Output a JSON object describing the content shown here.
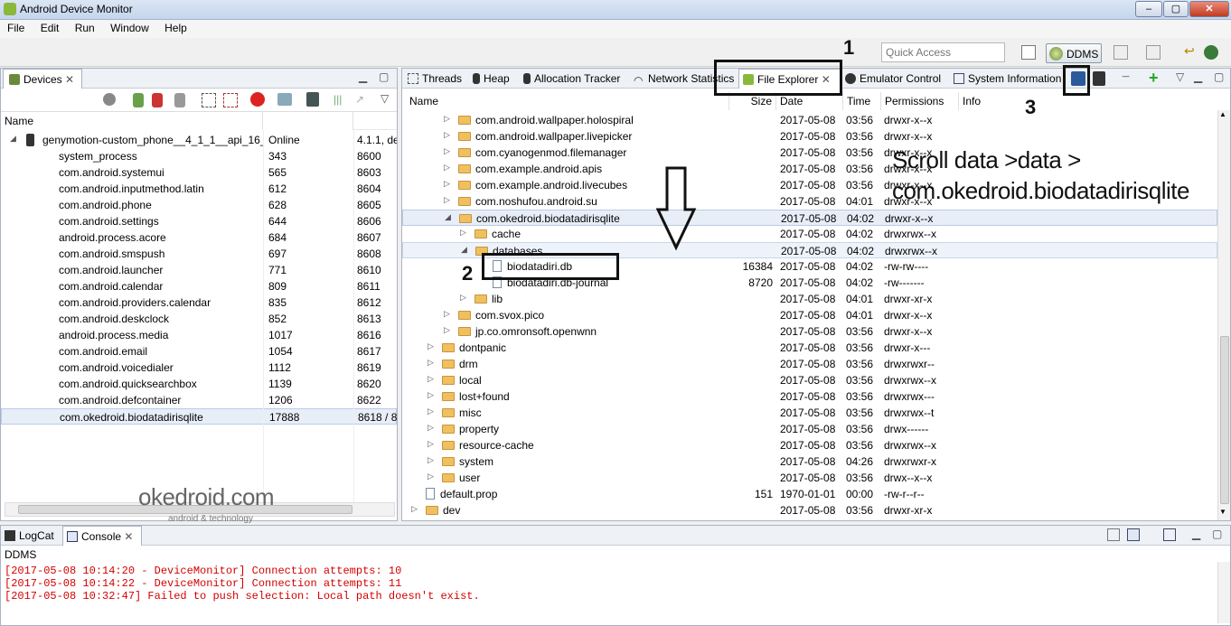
{
  "window": {
    "title": "Android Device Monitor",
    "min": "–",
    "max": "▢",
    "close": "✕"
  },
  "menu": [
    "File",
    "Edit",
    "Run",
    "Window",
    "Help"
  ],
  "toolbar": {
    "quick_access_placeholder": "Quick Access",
    "perspective": "DDMS"
  },
  "devices": {
    "tab": "Devices",
    "header": "Name",
    "device": {
      "name": "genymotion-custom_phone__4_1_1__api_16_",
      "status": "Online",
      "version": "4.1.1, de"
    },
    "processes": [
      {
        "name": "system_process",
        "pid": "343",
        "port": "8600"
      },
      {
        "name": "com.android.systemui",
        "pid": "565",
        "port": "8603"
      },
      {
        "name": "com.android.inputmethod.latin",
        "pid": "612",
        "port": "8604"
      },
      {
        "name": "com.android.phone",
        "pid": "628",
        "port": "8605"
      },
      {
        "name": "com.android.settings",
        "pid": "644",
        "port": "8606"
      },
      {
        "name": "android.process.acore",
        "pid": "684",
        "port": "8607"
      },
      {
        "name": "com.android.smspush",
        "pid": "697",
        "port": "8608"
      },
      {
        "name": "com.android.launcher",
        "pid": "771",
        "port": "8610"
      },
      {
        "name": "com.android.calendar",
        "pid": "809",
        "port": "8611"
      },
      {
        "name": "com.android.providers.calendar",
        "pid": "835",
        "port": "8612"
      },
      {
        "name": "com.android.deskclock",
        "pid": "852",
        "port": "8613"
      },
      {
        "name": "android.process.media",
        "pid": "1017",
        "port": "8616"
      },
      {
        "name": "com.android.email",
        "pid": "1054",
        "port": "8617"
      },
      {
        "name": "com.android.voicedialer",
        "pid": "1112",
        "port": "8619"
      },
      {
        "name": "com.android.quicksearchbox",
        "pid": "1139",
        "port": "8620"
      },
      {
        "name": "com.android.defcontainer",
        "pid": "1206",
        "port": "8622"
      },
      {
        "name": "com.okedroid.biodatadirisqlite",
        "pid": "17888",
        "port": "8618 / 8"
      }
    ]
  },
  "tabs": [
    "Threads",
    "Heap",
    "Allocation Tracker",
    "Network Statistics",
    "File Explorer",
    "Emulator Control",
    "System Information"
  ],
  "explorer": {
    "headers": [
      "Name",
      "Size",
      "Date",
      "Time",
      "Permissions",
      "Info"
    ],
    "rows": [
      {
        "name": "com.android.wallpaper.holospiral",
        "type": "folder",
        "depth": 2,
        "size": "",
        "date": "2017-05-08",
        "time": "03:56",
        "perm": "drwxr-x--x"
      },
      {
        "name": "com.android.wallpaper.livepicker",
        "type": "folder",
        "depth": 2,
        "size": "",
        "date": "2017-05-08",
        "time": "03:56",
        "perm": "drwxr-x--x"
      },
      {
        "name": "com.cyanogenmod.filemanager",
        "type": "folder",
        "depth": 2,
        "size": "",
        "date": "2017-05-08",
        "time": "03:56",
        "perm": "drwxr-x--x"
      },
      {
        "name": "com.example.android.apis",
        "type": "folder",
        "depth": 2,
        "size": "",
        "date": "2017-05-08",
        "time": "03:56",
        "perm": "drwxr-x--x"
      },
      {
        "name": "com.example.android.livecubes",
        "type": "folder",
        "depth": 2,
        "size": "",
        "date": "2017-05-08",
        "time": "03:56",
        "perm": "drwxr-x--x"
      },
      {
        "name": "com.noshufou.android.su",
        "type": "folder",
        "depth": 2,
        "size": "",
        "date": "2017-05-08",
        "time": "04:01",
        "perm": "drwxr-x--x"
      },
      {
        "name": "com.okedroid.biodatadirisqlite",
        "type": "folder",
        "depth": 2,
        "open": true,
        "size": "",
        "date": "2017-05-08",
        "time": "04:02",
        "perm": "drwxr-x--x"
      },
      {
        "name": "cache",
        "type": "folder",
        "depth": 3,
        "size": "",
        "date": "2017-05-08",
        "time": "04:02",
        "perm": "drwxrwx--x"
      },
      {
        "name": "databases",
        "type": "folder",
        "depth": 3,
        "open": true,
        "size": "",
        "date": "2017-05-08",
        "time": "04:02",
        "perm": "drwxrwx--x"
      },
      {
        "name": "biodatadiri.db",
        "type": "file",
        "depth": 4,
        "size": "16384",
        "date": "2017-05-08",
        "time": "04:02",
        "perm": "-rw-rw----"
      },
      {
        "name": "biodatadiri.db-journal",
        "type": "file",
        "depth": 4,
        "size": "8720",
        "date": "2017-05-08",
        "time": "04:02",
        "perm": "-rw-------"
      },
      {
        "name": "lib",
        "type": "folder",
        "depth": 3,
        "size": "",
        "date": "2017-05-08",
        "time": "04:01",
        "perm": "drwxr-xr-x"
      },
      {
        "name": "com.svox.pico",
        "type": "folder",
        "depth": 2,
        "size": "",
        "date": "2017-05-08",
        "time": "04:01",
        "perm": "drwxr-x--x"
      },
      {
        "name": "jp.co.omronsoft.openwnn",
        "type": "folder",
        "depth": 2,
        "size": "",
        "date": "2017-05-08",
        "time": "03:56",
        "perm": "drwxr-x--x"
      },
      {
        "name": "dontpanic",
        "type": "folder",
        "depth": 1,
        "size": "",
        "date": "2017-05-08",
        "time": "03:56",
        "perm": "drwxr-x---"
      },
      {
        "name": "drm",
        "type": "folder",
        "depth": 1,
        "size": "",
        "date": "2017-05-08",
        "time": "03:56",
        "perm": "drwxrwxr--"
      },
      {
        "name": "local",
        "type": "folder",
        "depth": 1,
        "size": "",
        "date": "2017-05-08",
        "time": "03:56",
        "perm": "drwxrwx--x"
      },
      {
        "name": "lost+found",
        "type": "folder",
        "depth": 1,
        "size": "",
        "date": "2017-05-08",
        "time": "03:56",
        "perm": "drwxrwx---"
      },
      {
        "name": "misc",
        "type": "folder",
        "depth": 1,
        "size": "",
        "date": "2017-05-08",
        "time": "03:56",
        "perm": "drwxrwx--t"
      },
      {
        "name": "property",
        "type": "folder",
        "depth": 1,
        "size": "",
        "date": "2017-05-08",
        "time": "03:56",
        "perm": "drwx------"
      },
      {
        "name": "resource-cache",
        "type": "folder",
        "depth": 1,
        "size": "",
        "date": "2017-05-08",
        "time": "03:56",
        "perm": "drwxrwx--x"
      },
      {
        "name": "system",
        "type": "folder",
        "depth": 1,
        "size": "",
        "date": "2017-05-08",
        "time": "04:26",
        "perm": "drwxrwxr-x"
      },
      {
        "name": "user",
        "type": "folder",
        "depth": 1,
        "size": "",
        "date": "2017-05-08",
        "time": "03:56",
        "perm": "drwx--x--x"
      },
      {
        "name": "default.prop",
        "type": "file",
        "depth": 0,
        "size": "151",
        "date": "1970-01-01",
        "time": "00:00",
        "perm": "-rw-r--r--"
      },
      {
        "name": "dev",
        "type": "folder",
        "depth": 0,
        "size": "",
        "date": "2017-05-08",
        "time": "03:56",
        "perm": "drwxr-xr-x"
      }
    ]
  },
  "bottom": {
    "tabs": [
      "LogCat",
      "Console"
    ],
    "console_name": "DDMS",
    "lines": [
      "[2017-05-08 10:14:20 - DeviceMonitor] Connection attempts: 10",
      "[2017-05-08 10:14:22 - DeviceMonitor] Connection attempts: 11",
      "[2017-05-08 10:32:47] Failed to push selection: Local path doesn't exist."
    ]
  },
  "annotations": {
    "n1": "1",
    "n2": "2",
    "n3": "3",
    "note_line1": "Scroll data >data >",
    "note_line2": "com.okedroid.biodatadirisqlite",
    "watermark": "okedroid.com",
    "watermark_sub": "android & technology"
  },
  "colors": {
    "console_error": "#d40000",
    "selection": "#e8eef8",
    "folder": "#f0c060"
  }
}
